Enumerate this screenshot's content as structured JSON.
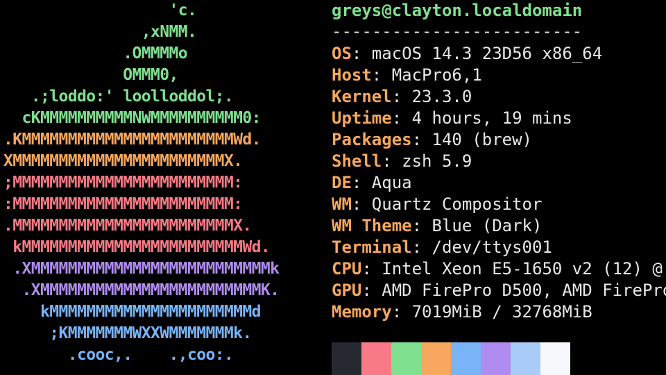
{
  "terminal": {
    "colors": {
      "background": "#000000",
      "key": "#f7a75e",
      "text": "#e8e8e8",
      "title": "#7fe08f"
    },
    "logo": {
      "lines": [
        {
          "text": "                  'c.",
          "color": "#7fe08f"
        },
        {
          "text": "               ,xNMM.",
          "color": "#7fe08f"
        },
        {
          "text": "             .OMMMMo",
          "color": "#7fe08f"
        },
        {
          "text": "             OMMM0,",
          "color": "#7fe08f"
        },
        {
          "text": "   .;loddo:' loolloddol;.",
          "color": "#7fe08f"
        },
        {
          "text": "  cKMMMMMMMMMMNWMMMMMMMMMM0:",
          "color": "#7fe08f"
        },
        {
          "text": ".KMMMMMMMMMMMMMMMMMMMMMMMWd.",
          "color": "#f7a75e"
        },
        {
          "text": "XMMMMMMMMMMMMMMMMMMMMMMMX.",
          "color": "#f7a75e"
        },
        {
          "text": ";MMMMMMMMMMMMMMMMMMMMMMMM:",
          "color": "#f87a86"
        },
        {
          "text": ":MMMMMMMMMMMMMMMMMMMMMMMM:",
          "color": "#f87a86"
        },
        {
          "text": ".MMMMMMMMMMMMMMMMMMMMMMMMX.",
          "color": "#f87a86"
        },
        {
          "text": " kMMMMMMMMMMMMMMMMMMMMMMMMWd.",
          "color": "#f87a86"
        },
        {
          "text": " .XMMMMMMMMMMMMMMMMMMMMMMMMMMk",
          "color": "#b08cf0"
        },
        {
          "text": "  .XMMMMMMMMMMMMMMMMMMMMMMMMK.",
          "color": "#b08cf0"
        },
        {
          "text": "    kMMMMMMMMMMMMMMMMMMMMMMd",
          "color": "#79b4f7"
        },
        {
          "text": "     ;KMMMMMMMWXXWMMMMMMMk.",
          "color": "#79b4f7"
        },
        {
          "text": "       .cooc,.    .,coo:.",
          "color": "#79b4f7"
        }
      ]
    },
    "info": {
      "title": "greys@clayton.localdomain",
      "separator": "-------------------------",
      "fields": [
        {
          "key": "OS",
          "value": ": macOS 14.3 23D56 x86_64"
        },
        {
          "key": "Host",
          "value": ": MacPro6,1"
        },
        {
          "key": "Kernel",
          "value": ": 23.3.0"
        },
        {
          "key": "Uptime",
          "value": ": 4 hours, 19 mins"
        },
        {
          "key": "Packages",
          "value": ": 140 (brew)"
        },
        {
          "key": "Shell",
          "value": ": zsh 5.9"
        },
        {
          "key": "DE",
          "value": ": Aqua"
        },
        {
          "key": "WM",
          "value": ": Quartz Compositor"
        },
        {
          "key": "WM Theme",
          "value": ": Blue (Dark)"
        },
        {
          "key": "Terminal",
          "value": ": /dev/ttys001"
        },
        {
          "key": "CPU",
          "value": ": Intel Xeon E5-1650 v2 (12) @"
        },
        {
          "key": "GPU",
          "value": ": AMD FirePro D500, AMD FirePro"
        },
        {
          "key": "Memory",
          "value": ": 7019MiB / 32768MiB"
        }
      ]
    },
    "palette": [
      "#262a30",
      "#f87a86",
      "#7fe08f",
      "#f7a75e",
      "#79b4f7",
      "#b08cf0",
      "#a8ccf7",
      "#f7f8fb"
    ]
  }
}
